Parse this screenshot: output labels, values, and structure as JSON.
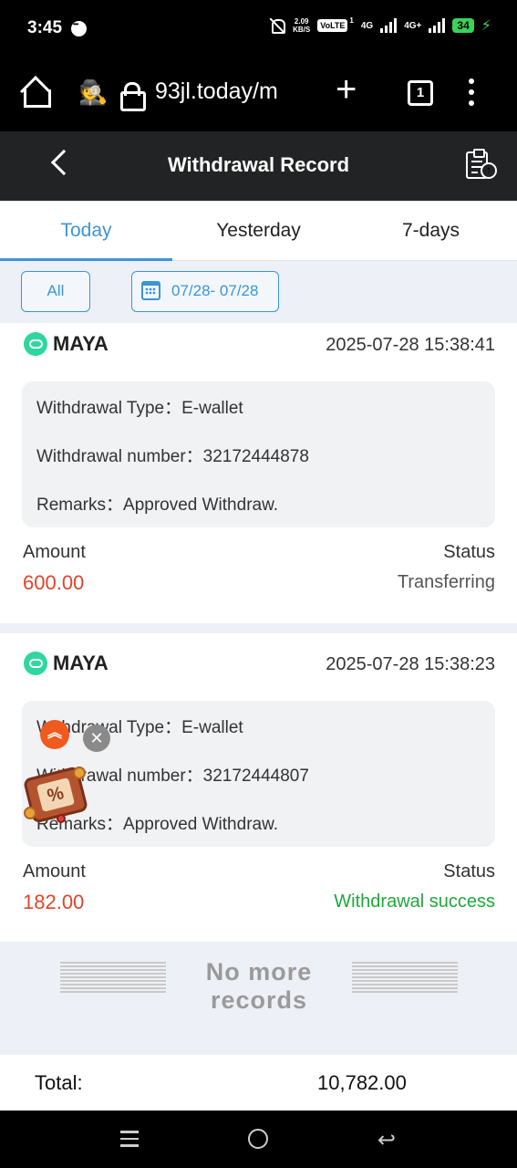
{
  "status_bar": {
    "time": "3:45",
    "net_speed_value": "2.09",
    "net_speed_unit": "KB/S",
    "volte": "VoLTE",
    "volte_sim": "1",
    "net1": "4G",
    "net2": "4G+",
    "battery": "34"
  },
  "browser": {
    "url": "93jl.today/m",
    "tab_count": "1"
  },
  "header": {
    "title": "Withdrawal Record"
  },
  "tabs": [
    {
      "label": "Today",
      "active": true
    },
    {
      "label": "Yesterday",
      "active": false
    },
    {
      "label": "7-days",
      "active": false
    }
  ],
  "filters": {
    "all_label": "All",
    "date_range": "07/28- 07/28"
  },
  "records": [
    {
      "method": "MAYA",
      "datetime": "2025-07-28 15:38:41",
      "type_label": "Withdrawal Type：",
      "type_value": "E-wallet",
      "number_label": "Withdrawal number：",
      "number_value": "32172444878",
      "remarks_label": "Remarks：",
      "remarks_value": "Approved Withdraw.",
      "amount_label": "Amount",
      "amount": "600.00",
      "status_label": "Status",
      "status": "Transferring",
      "status_color": "#555555"
    },
    {
      "method": "MAYA",
      "datetime": "2025-07-28 15:38:23",
      "type_label": "Withdrawal Type：",
      "type_value": "E-wallet",
      "number_label": "Withdrawal number：",
      "number_value": "32172444807",
      "remarks_label": "Remarks：",
      "remarks_value": "Approved Withdraw.",
      "amount_label": "Amount",
      "amount": "182.00",
      "status_label": "Status",
      "status": "Withdrawal success",
      "status_color": "#1fa83a"
    }
  ],
  "no_more": "No more records",
  "total": {
    "label": "Total:",
    "value": "10,782.00"
  },
  "colors": {
    "accent": "#3b94d8",
    "amount": "#e0452b",
    "header_bg": "#222325"
  }
}
